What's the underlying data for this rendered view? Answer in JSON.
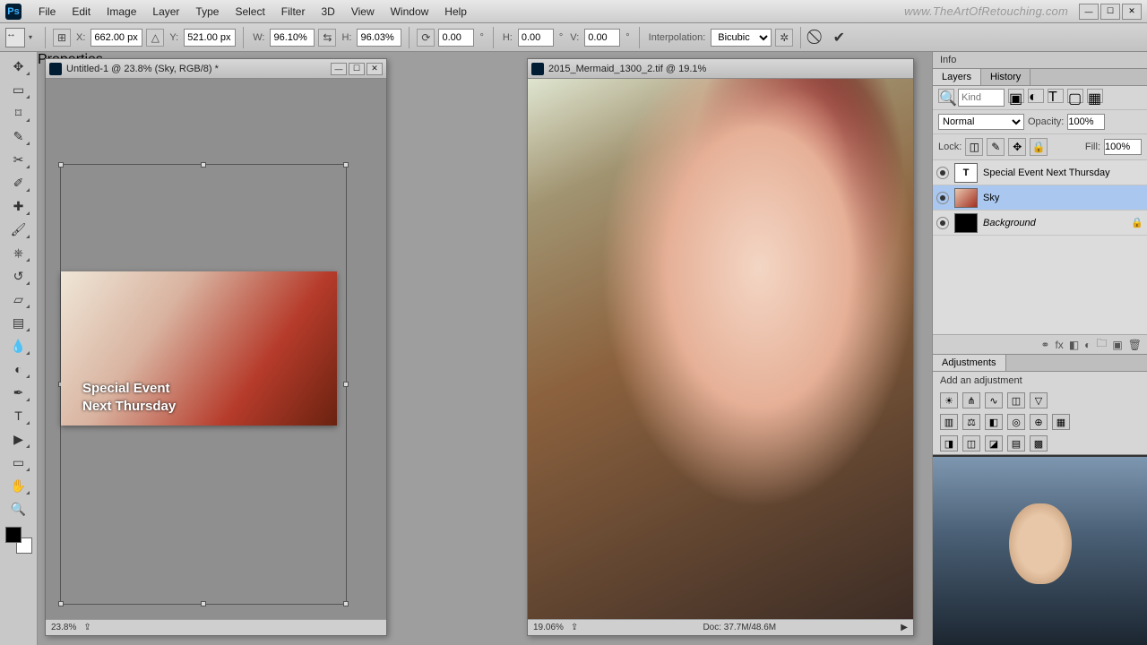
{
  "brand_url": "www.TheArtOfRetouching.com",
  "menu": [
    "File",
    "Edit",
    "Image",
    "Layer",
    "Type",
    "Select",
    "Filter",
    "3D",
    "View",
    "Window",
    "Help"
  ],
  "options": {
    "x_label": "X:",
    "x": "662.00 px",
    "y_label": "Y:",
    "y": "521.00 px",
    "w_label": "W:",
    "w": "96.10%",
    "h_label": "H:",
    "h": "96.03%",
    "rot": "0.00",
    "sh_h_label": "H:",
    "sh_h": "0.00",
    "sh_v_label": "V:",
    "sh_v": "0.00",
    "interp_label": "Interpolation:",
    "interp": "Bicubic"
  },
  "doc1": {
    "title": "Untitled-1 @ 23.8% (Sky, RGB/8) *",
    "zoom": "23.8%",
    "text_line1": "Special Event",
    "text_line2": "Next Thursday"
  },
  "doc2": {
    "title": "2015_Mermaid_1300_2.tif @ 19.1%",
    "zoom": "19.06%",
    "docinfo": "Doc: 37.7M/48.6M",
    "extra_tab": "Properties"
  },
  "panels": {
    "info_tab": "Info",
    "layers_tab": "Layers",
    "history_tab": "History",
    "kind_placeholder": "Kind",
    "blend_mode": "Normal",
    "opacity_label": "Opacity:",
    "opacity": "100%",
    "lock_label": "Lock:",
    "fill_label": "Fill:",
    "fill": "100%",
    "layers": [
      {
        "name": "Special Event Next Thursday",
        "type": "T"
      },
      {
        "name": "Sky",
        "type": "img",
        "selected": true
      },
      {
        "name": "Background",
        "type": "solid",
        "locked": true
      }
    ],
    "adjustments_tab": "Adjustments",
    "add_adj": "Add an adjustment"
  }
}
